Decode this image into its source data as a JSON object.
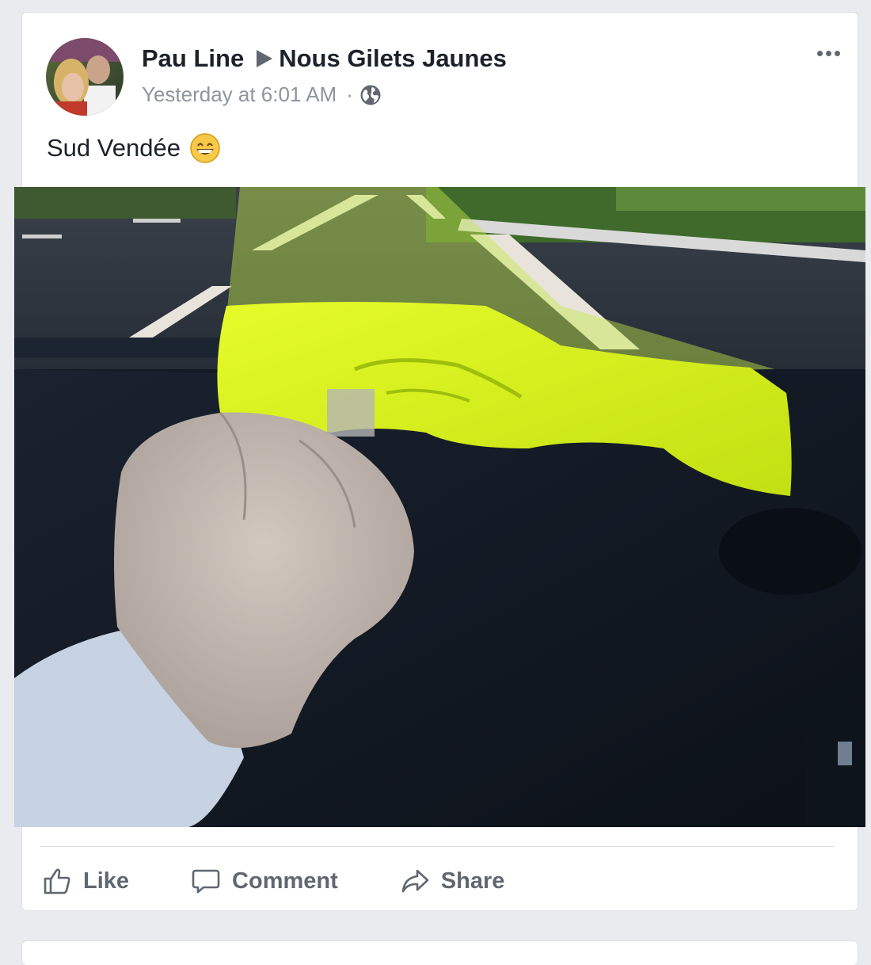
{
  "post": {
    "author": "Pau Line",
    "group": "Nous Gilets Jaunes",
    "timestamp": "Yesterday at 6:01 AM",
    "separator": "·",
    "privacy_icon": "globe-icon",
    "text": "Sud Vendée",
    "emoji": "grinning-face-icon",
    "photo_description_icon": "photo-yellow-vest-dashboard"
  },
  "actions": {
    "like_label": "Like",
    "comment_label": "Comment",
    "share_label": "Share"
  },
  "colors": {
    "background": "#e9ebee",
    "text_primary": "#1d2129",
    "text_secondary": "#90949c",
    "action_text": "#606770",
    "vest_yellow": "#d7f21a"
  }
}
